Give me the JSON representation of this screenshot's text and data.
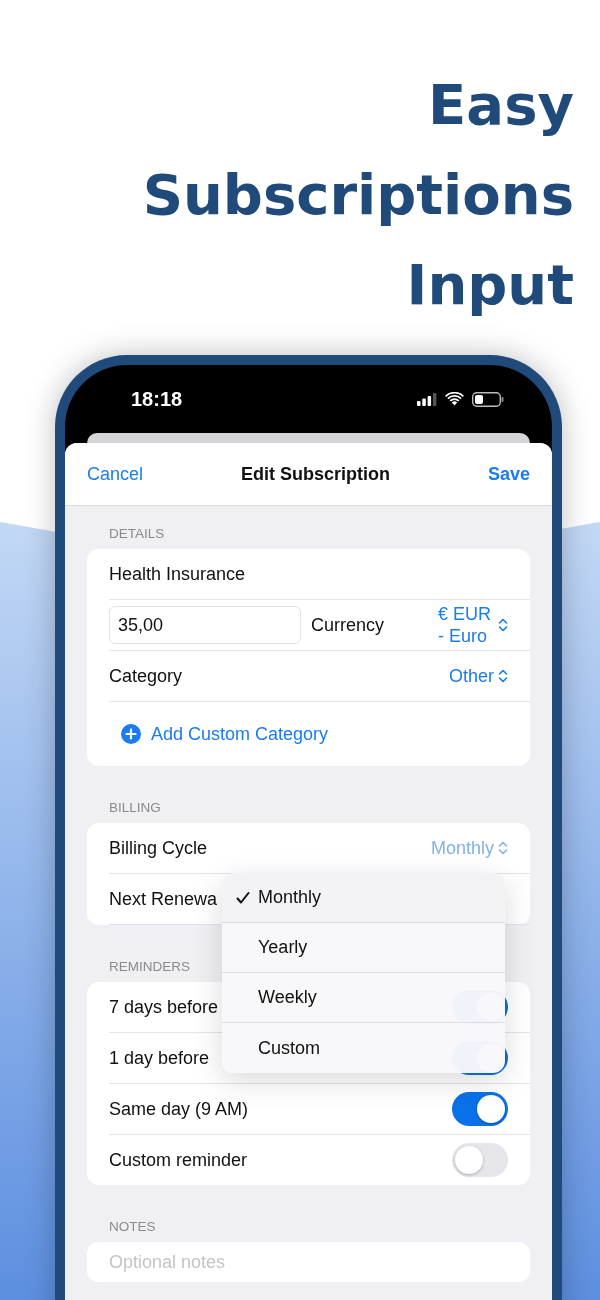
{
  "headline": [
    "Easy",
    "Subscriptions",
    "Input"
  ],
  "status_bar": {
    "time": "18:18"
  },
  "nav": {
    "cancel": "Cancel",
    "title": "Edit Subscription",
    "save": "Save"
  },
  "sections": [
    {
      "header": "DETAILS",
      "rows": [
        {
          "kind": "text",
          "label": "Health Insurance"
        },
        {
          "kind": "amount",
          "amount": "35,00",
          "label": "Currency",
          "picker": "€ EUR - Euro"
        },
        {
          "kind": "picker",
          "label": "Category",
          "picker": "Other",
          "dimmed": false
        },
        {
          "kind": "action",
          "label": "Add Custom Category"
        }
      ]
    },
    {
      "header": "BILLING",
      "rows": [
        {
          "kind": "picker",
          "label": "Billing Cycle",
          "picker": "Monthly",
          "dimmed": true
        },
        {
          "kind": "text",
          "label": "Next Renewa"
        }
      ],
      "menu": [
        {
          "label": "Monthly",
          "selected": true
        },
        {
          "label": "Yearly",
          "selected": false
        },
        {
          "label": "Weekly",
          "selected": false
        },
        {
          "label": "Custom",
          "selected": false
        }
      ]
    },
    {
      "header": "REMINDERS",
      "rows": [
        {
          "kind": "toggle",
          "label": "7 days before",
          "on": true
        },
        {
          "kind": "toggle",
          "label": "1 day before",
          "on": true
        },
        {
          "kind": "toggle",
          "label": "Same day (9 AM)",
          "on": true
        },
        {
          "kind": "toggle",
          "label": "Custom reminder",
          "on": false
        }
      ]
    },
    {
      "header": "NOTES",
      "rows": [
        {
          "kind": "notes",
          "placeholder": "Optional notes"
        }
      ]
    }
  ]
}
